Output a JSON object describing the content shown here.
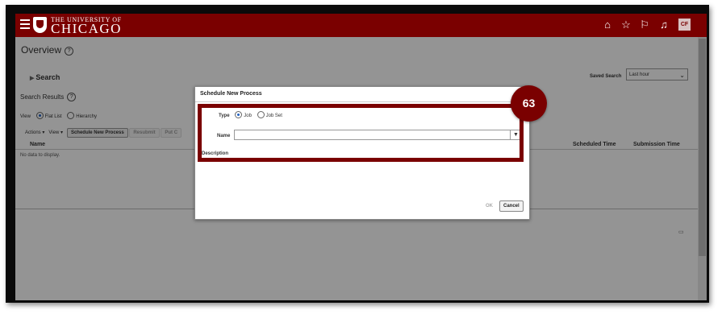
{
  "header": {
    "university_small": "THE UNIVERSITY OF",
    "university_big": "CHICAGO",
    "avatar_initials": "CF"
  },
  "page": {
    "title": "Overview",
    "search_heading": "Search",
    "saved_search_label": "Saved Search",
    "saved_search_value": "Last hour",
    "search_results_label": "Search Results",
    "view_label": "View",
    "view_options": [
      "Flat List",
      "Hierarchy"
    ],
    "actions_label": "Actions ▾",
    "view_menu_label": "View ▾",
    "schedule_button": "Schedule New Process",
    "resubmit_button": "Resubmit",
    "put_on_hold_button": "Put C",
    "columns": [
      "Name",
      "Scheduled Time",
      "Submission Time"
    ],
    "no_data": "No data to display."
  },
  "dialog": {
    "title": "Schedule New Process",
    "type_label": "Type",
    "type_options": [
      "Job",
      "Job Set"
    ],
    "name_label": "Name",
    "name_value": "",
    "description_label": "Description",
    "ok_label": "OK",
    "cancel_label": "Cancel"
  },
  "step_badge": "63",
  "colors": {
    "brand": "#7a0000"
  }
}
